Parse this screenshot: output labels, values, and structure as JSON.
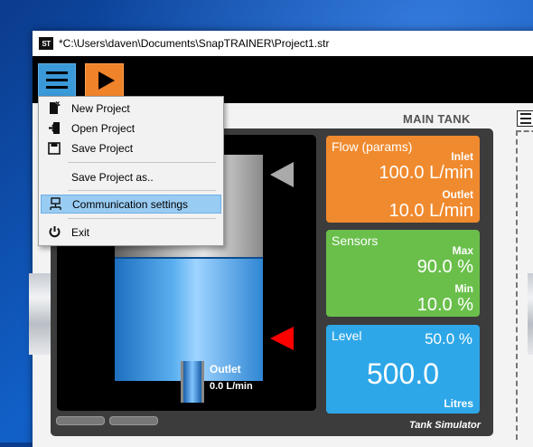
{
  "window": {
    "title": "*C:\\Users\\daven\\Documents\\SnapTRAINER\\Project1.str",
    "logo_text": "ST"
  },
  "tank": {
    "title": "MAIN TANK",
    "outlet_label": "Outlet",
    "outlet_value": "0.0 L/min",
    "simulator_label": "Tank Simulator"
  },
  "flow": {
    "title": "Flow (params)",
    "inlet_label": "Inlet",
    "inlet_value": "100.0 L/min",
    "outlet_label": "Outlet",
    "outlet_value": "10.0 L/min",
    "color": "#f08a2e"
  },
  "sensors": {
    "title": "Sensors",
    "max_label": "Max",
    "max_value": "90.0 %",
    "min_label": "Min",
    "min_value": "10.0 %",
    "color": "#6abf4b"
  },
  "level": {
    "title": "Level",
    "percent": "50.0 %",
    "value": "500.0",
    "unit": "Litres",
    "fill_fraction": 0.5,
    "color": "#2ea7e8"
  },
  "menu": {
    "items": [
      {
        "label": "New Project",
        "icon": "new-file-icon"
      },
      {
        "label": "Open Project",
        "icon": "open-icon"
      },
      {
        "label": "Save Project",
        "icon": "save-icon"
      },
      {
        "label": "Save Project as..",
        "icon": ""
      },
      {
        "label": "Communication settings",
        "icon": "network-icon"
      },
      {
        "label": "Exit",
        "icon": "power-icon"
      }
    ],
    "highlighted_index": 4
  }
}
